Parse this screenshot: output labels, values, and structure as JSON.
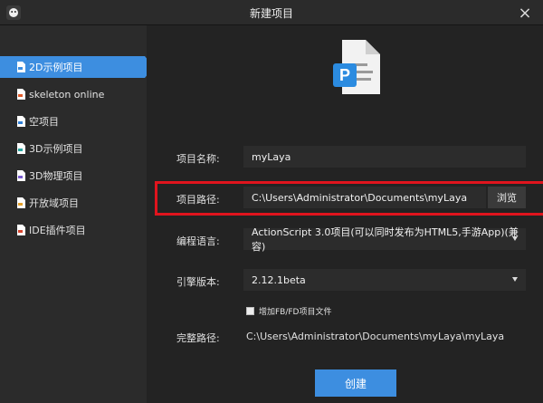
{
  "window": {
    "title": "新建项目"
  },
  "sidebar": {
    "items": [
      {
        "label": "2D示例项目",
        "active": true
      },
      {
        "label": "skeleton online"
      },
      {
        "label": "空项目"
      },
      {
        "label": "3D示例项目"
      },
      {
        "label": "3D物理项目"
      },
      {
        "label": "开放域项目"
      },
      {
        "label": "IDE插件项目"
      }
    ]
  },
  "form": {
    "name_label": "项目名称:",
    "name_value": "myLaya",
    "path_label": "项目路径:",
    "path_value": "C:\\Users\\Administrator\\Documents\\myLaya",
    "browse_label": "浏览",
    "language_label": "编程语言:",
    "language_value": "ActionScript 3.0项目(可以同时发布为HTML5,手游App)(兼容)",
    "engine_label": "引擎版本:",
    "engine_value": "2.12.1beta",
    "checkbox_label": "增加FB/FD项目文件",
    "checkbox_checked": false,
    "full_path_label": "完整路径:",
    "full_path_value": "C:\\Users\\Administrator\\Documents\\myLaya\\myLaya"
  },
  "actions": {
    "create_label": "创建"
  },
  "colors": {
    "accent": "#3d8ee0",
    "highlight": "#e0141d"
  },
  "icons": {
    "app": "app-logo-icon",
    "close": "close-icon",
    "document": "project-document-icon"
  }
}
